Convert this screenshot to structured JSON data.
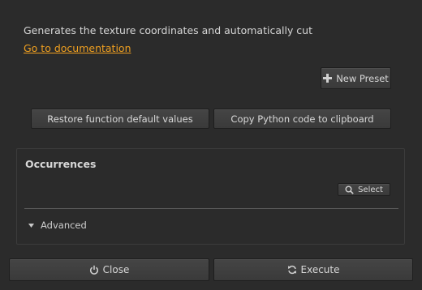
{
  "description": "Generates the texture coordinates and automatically cut",
  "doc_link": "Go to documentation",
  "buttons": {
    "new_preset": "New Preset",
    "restore_defaults": "Restore function default values",
    "copy_python": "Copy Python code to clipboard",
    "close": "Close",
    "execute": "Execute"
  },
  "occurrences": {
    "title": "Occurrences",
    "select_label": "Select",
    "advanced_label": "Advanced"
  },
  "icons": {
    "new_preset": "plus-icon",
    "select": "search-icon",
    "advanced": "triangle-down-icon",
    "close": "power-icon",
    "execute": "refresh-icon"
  },
  "colors": {
    "background": "#2b2b2b",
    "link": "#f0a020",
    "text": "#d6d6d6"
  }
}
